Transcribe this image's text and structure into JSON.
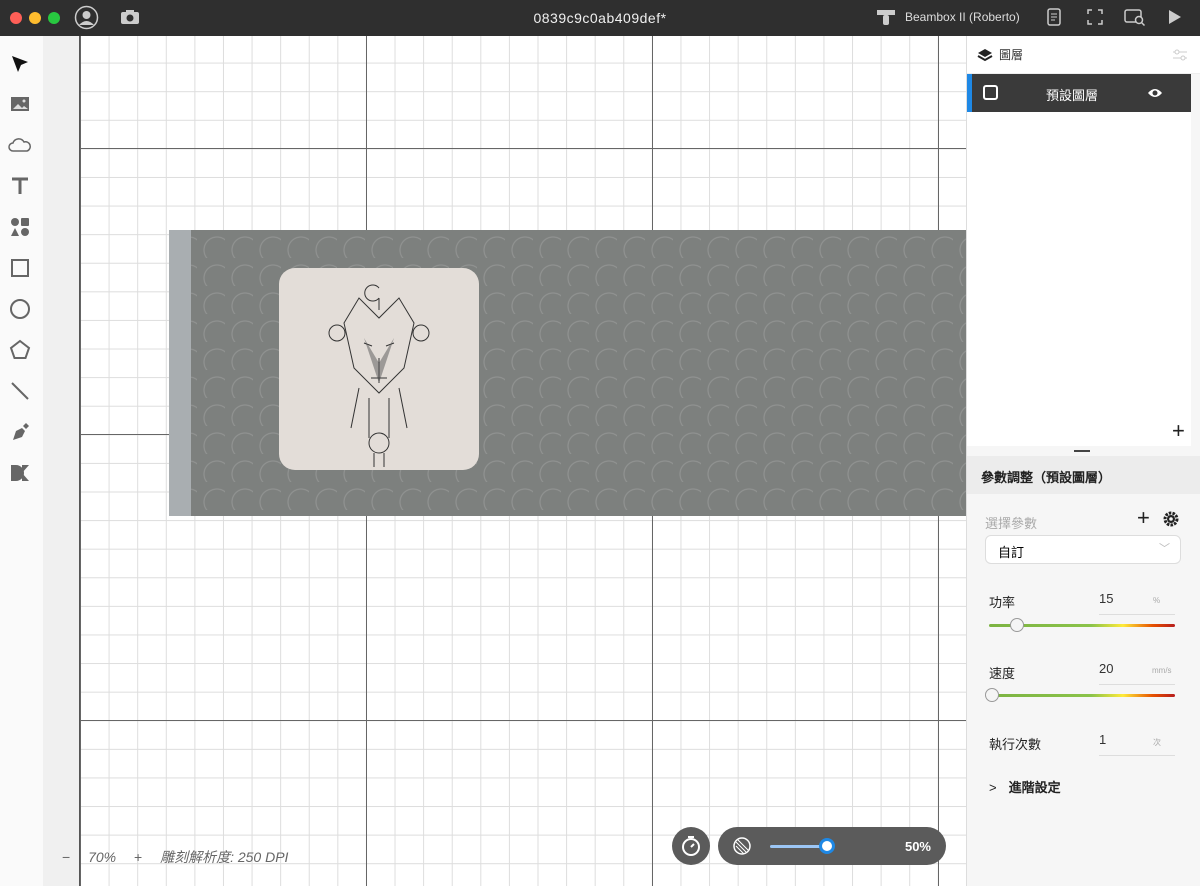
{
  "window": {
    "title": "0839c9c0ab409def*",
    "machine": "Beambox II (Roberto)"
  },
  "tools": [
    "select",
    "image",
    "cloud",
    "text",
    "elements",
    "rectangle",
    "ellipse",
    "polygon",
    "line",
    "pen",
    "dmkt"
  ],
  "layers": {
    "header": "圖層",
    "items": [
      {
        "name": "預設圖層",
        "visible": true
      }
    ]
  },
  "params": {
    "title": "參數調整（預設圖層）",
    "preset_label": "選擇參數",
    "preset_value": "自訂",
    "power": {
      "label": "功率",
      "value": "15",
      "unit": "%",
      "fraction": 0.15
    },
    "speed": {
      "label": "速度",
      "value": "20",
      "unit": "mm/s",
      "fraction": 0.0
    },
    "repeat": {
      "label": "執行次數",
      "value": "1",
      "unit": "次"
    },
    "advanced": "進階設定"
  },
  "canvas": {
    "zoom": "70%",
    "zoom_minus": "−",
    "zoom_plus": "+",
    "resolution": "雕刻解析度: 250 DPI",
    "opacity": "50%",
    "opacity_fraction": 0.5
  }
}
